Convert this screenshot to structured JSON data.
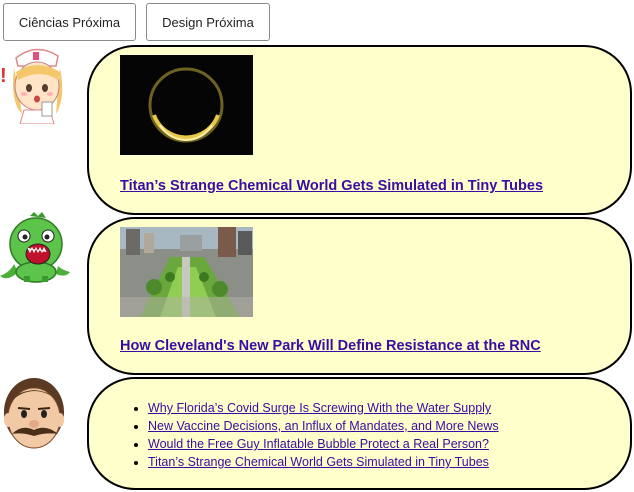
{
  "nav": {
    "prev_label": "Ciências Próxima",
    "next_label": "Design Próxima"
  },
  "colors": {
    "bubble_fill": "#ffffcc",
    "link": "#3a0ca3",
    "border": "#000000"
  },
  "posts": [
    {
      "avatar_icon": "nurse-girl-icon",
      "image_icon": "eclipse-ring-image",
      "title": "Titan’s Strange Chemical World Gets Simulated in Tiny Tubes"
    },
    {
      "avatar_icon": "green-dinosaur-icon",
      "image_icon": "city-park-aerial-image",
      "title": "How Cleveland's New Park Will Define Resistance at the RNC"
    }
  ],
  "list_post": {
    "avatar_icon": "mustache-man-icon",
    "items": [
      "Why Florida’s Covid Surge Is Screwing With the Water Supply",
      "New Vaccine Decisions, an Influx of Mandates, and More News",
      "Would the Free Guy Inflatable Bubble Protect a Real Person?",
      "Titan’s Strange Chemical World Gets Simulated in Tiny Tubes"
    ]
  }
}
